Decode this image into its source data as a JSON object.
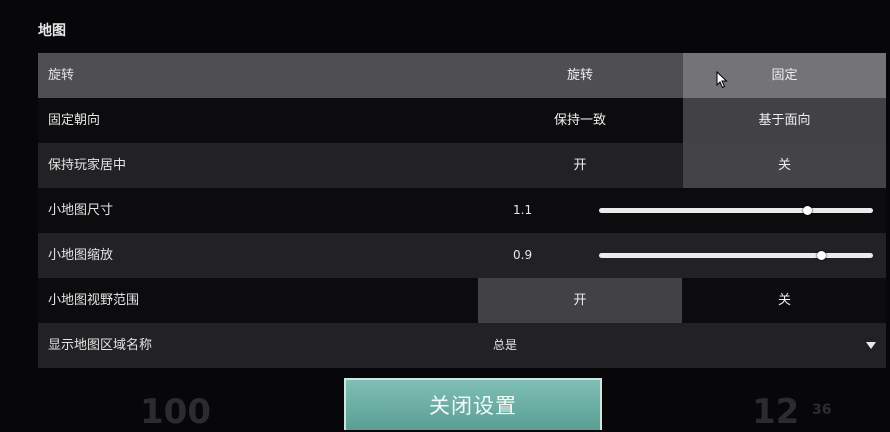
{
  "section": {
    "title": "地图"
  },
  "rows": [
    {
      "label": "旋转",
      "type": "toggle",
      "options": [
        "旋转",
        "固定"
      ],
      "selected": 1,
      "hovered": true
    },
    {
      "label": "固定朝向",
      "type": "toggle",
      "options": [
        "保持一致",
        "基于面向"
      ],
      "selected": 1,
      "hovered": false
    },
    {
      "label": "保持玩家居中",
      "type": "toggle",
      "options": [
        "开",
        "关"
      ],
      "selected": 1,
      "hovered": false
    },
    {
      "label": "小地图尺寸",
      "type": "slider",
      "value_text": "1.1",
      "fraction": 0.76
    },
    {
      "label": "小地图缩放",
      "type": "slider",
      "value_text": "0.9",
      "fraction": 0.81
    },
    {
      "label": "小地图视野范围",
      "type": "toggle",
      "options": [
        "开",
        "关"
      ],
      "selected": 0,
      "hovered": false
    },
    {
      "label": "显示地图区域名称",
      "type": "dropdown",
      "value_text": "总是"
    }
  ],
  "close_button": {
    "label": "关闭设置"
  },
  "hud": {
    "left_number": "100",
    "right_number": "12",
    "right_small": "36"
  },
  "colors": {
    "accent": "#6fb1a7",
    "selected_option": "#46464a",
    "row_hover": "#5c5c60"
  }
}
